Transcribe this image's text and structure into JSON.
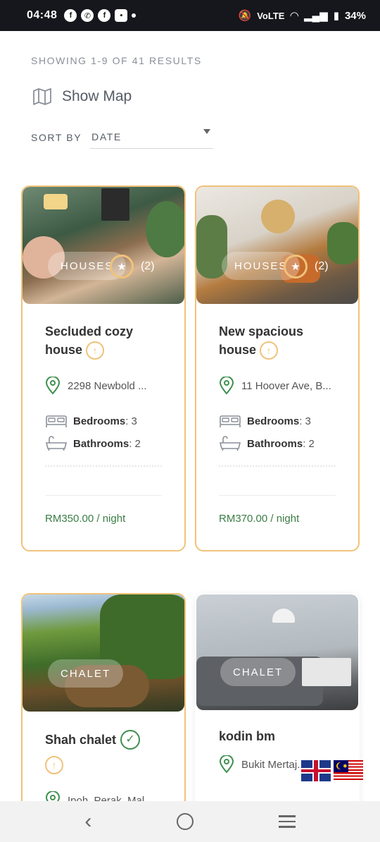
{
  "status_bar": {
    "time": "04:48",
    "notification_icons": [
      "facebook-icon",
      "whatsapp-icon",
      "facebook-icon",
      "app-icon"
    ],
    "volte_label": "VoLTE",
    "battery": "34%"
  },
  "header": {
    "results_text": "SHOWING 1-9 OF 41 RESULTS",
    "show_map_label": "Show Map",
    "sort_label": "SORT BY",
    "sort_value": "DATE"
  },
  "listings": [
    {
      "category": "HOUSES",
      "rating_count": "(2)",
      "title": "Secluded cozy house",
      "address": "2298 Newbold ...",
      "bedrooms_label": "Bedrooms",
      "bedrooms_value": ": 3",
      "bathrooms_label": "Bathrooms",
      "bathrooms_value": ": 2",
      "price": "RM350.00 / night"
    },
    {
      "category": "HOUSES",
      "rating_count": "(2)",
      "title": "New spacious house",
      "address": "11 Hoover Ave, B...",
      "bedrooms_label": "Bedrooms",
      "bedrooms_value": ": 3",
      "bathrooms_label": "Bathrooms",
      "bathrooms_value": ": 2",
      "price": "RM370.00 / night"
    },
    {
      "category": "CHALET",
      "title": "Shah chalet",
      "address": "Ipoh, Perak, Mal..."
    },
    {
      "category": "CHALET",
      "title": "kodin bm",
      "address": "Bukit Mertaj..."
    }
  ],
  "colors": {
    "accent": "#f0c27a",
    "price_green": "#3a7d44",
    "verified_green": "#3f8f4f"
  },
  "language_flags": [
    "uk-flag-icon",
    "malaysia-flag-icon"
  ],
  "nav_bar": [
    "back-icon",
    "home-icon",
    "recents-icon"
  ]
}
